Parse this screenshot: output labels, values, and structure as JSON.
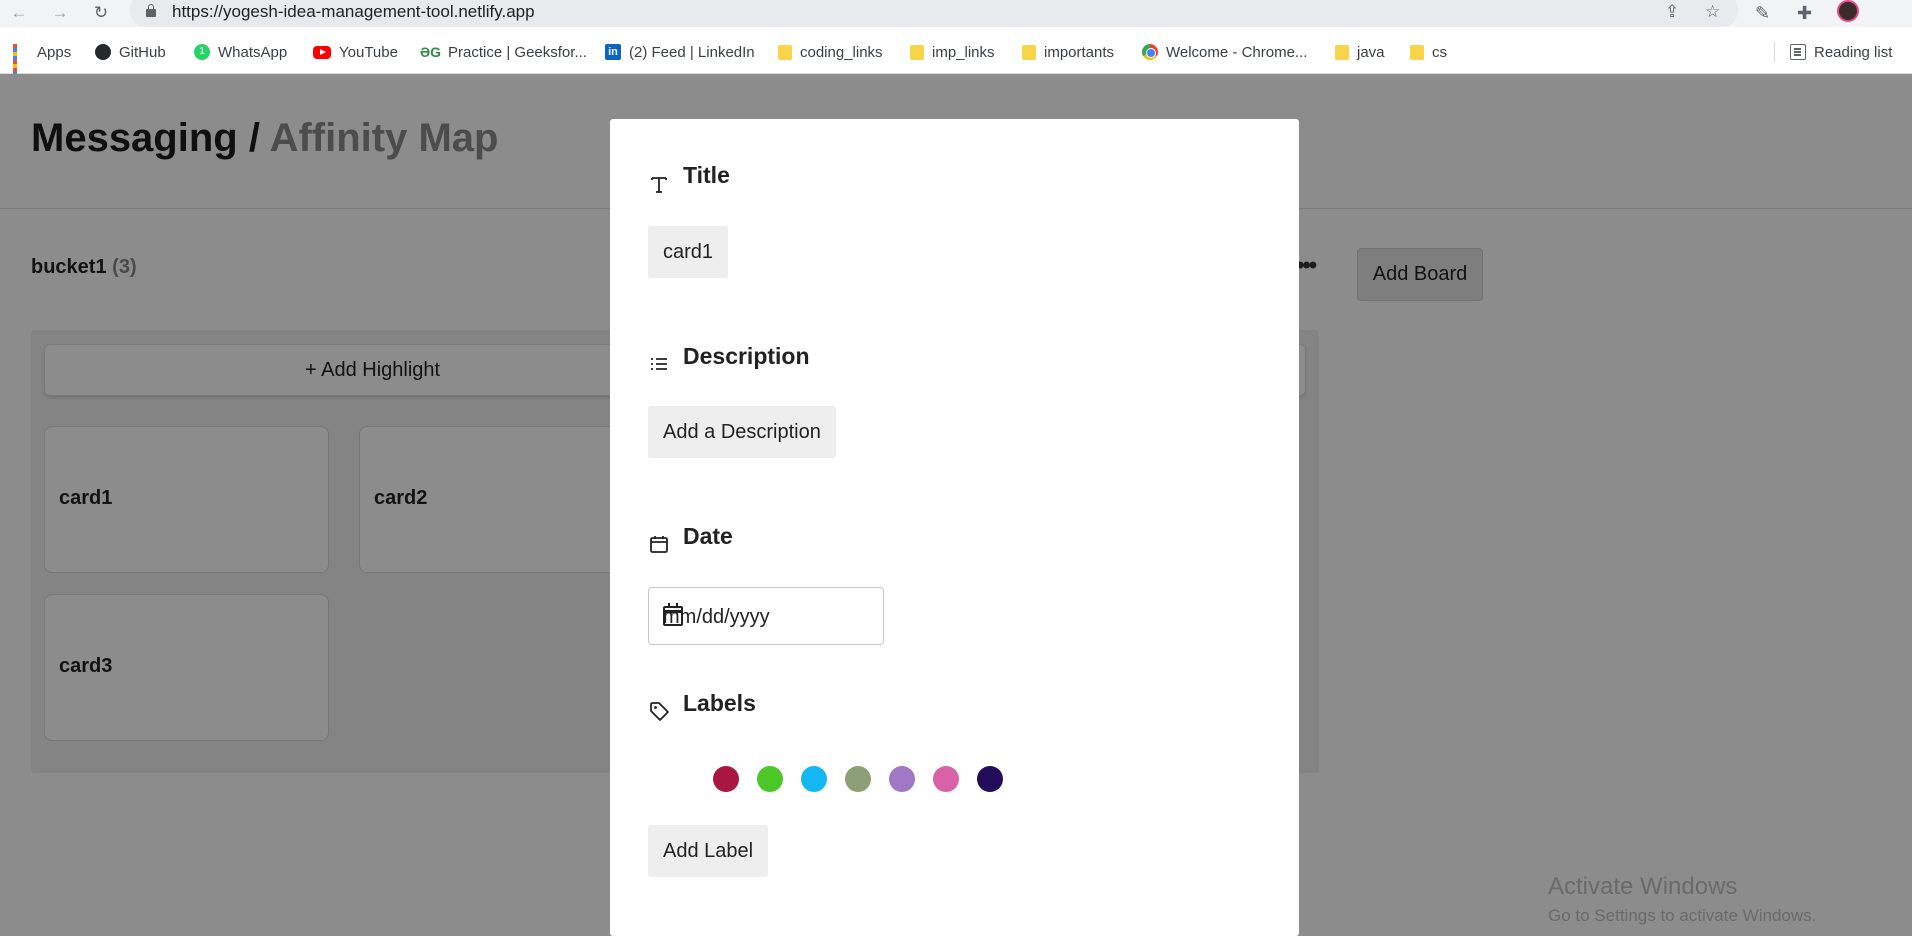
{
  "browser": {
    "url": "https://yogesh-idea-management-tool.netlify.app",
    "bookmarks": [
      {
        "label": "Apps",
        "icon": "apps-grid-icon"
      },
      {
        "label": "GitHub",
        "icon": "github-icon"
      },
      {
        "label": "WhatsApp",
        "icon": "whatsapp-icon"
      },
      {
        "label": "YouTube",
        "icon": "youtube-icon"
      },
      {
        "label": "Practice | GeeksforGeeks...",
        "display": "Practice | Geeksfor...",
        "icon": "geeksforgeeks-icon"
      },
      {
        "label": "(2) Feed | LinkedIn",
        "icon": "linkedin-icon"
      },
      {
        "label": "coding_links",
        "icon": "folder-icon"
      },
      {
        "label": "imp_links",
        "icon": "folder-icon"
      },
      {
        "label": "importants",
        "icon": "folder-icon"
      },
      {
        "label": "Welcome - Chrome...",
        "icon": "chrome-icon"
      },
      {
        "label": "java",
        "icon": "folder-icon"
      },
      {
        "label": "cs",
        "icon": "folder-icon"
      }
    ],
    "reading_list": "Reading list"
  },
  "page": {
    "breadcrumb_current": "Messaging /",
    "breadcrumb_sub": "Affinity Map",
    "board": {
      "name": "bucket1",
      "count": "(3)",
      "add_highlight": "+ Add Highlight",
      "cards": [
        "card1",
        "card2",
        "card3"
      ]
    },
    "add_board": "Add Board"
  },
  "modal": {
    "title_heading": "Title",
    "title_value": "card1",
    "description_heading": "Description",
    "description_button": "Add a Description",
    "date_heading": "Date",
    "date_placeholder": "mm/dd/yyyy",
    "labels_heading": "Labels",
    "label_colors": [
      "#a8173f",
      "#4bc728",
      "#14b7f2",
      "#8d9f76",
      "#a078c6",
      "#d762a8",
      "#230c5a"
    ],
    "add_label": "Add Label"
  },
  "watermark": {
    "line1": "Activate Windows",
    "line2": "Go to Settings to activate Windows."
  }
}
